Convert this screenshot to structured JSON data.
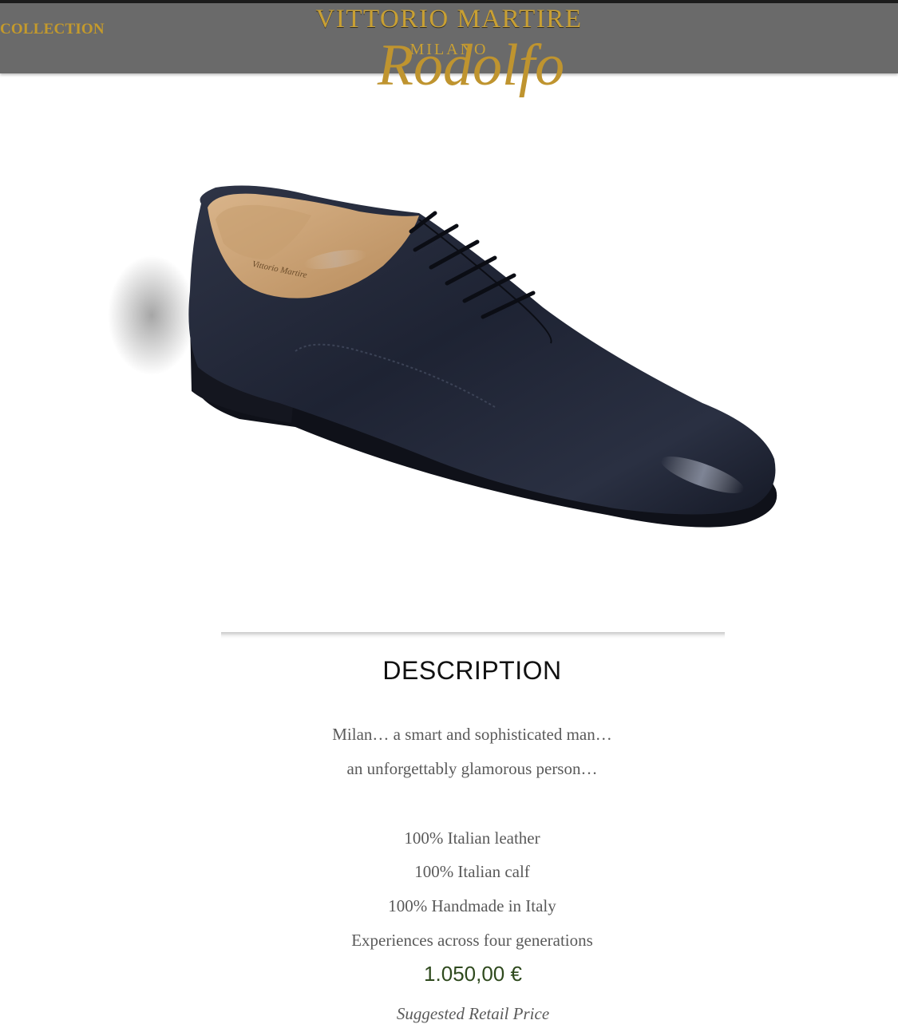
{
  "header": {
    "nav_collection": "COLLECTION",
    "brand_name": "VITTORIO MARTIRE",
    "brand_city": "MILANO",
    "product_name": "Rodolfo"
  },
  "product": {
    "image_alt": "navy blue leather oxford shoe"
  },
  "description": {
    "title": "DESCRIPTION",
    "intro": [
      "Milan… a smart and sophisticated man…",
      "an unforgettably glamorous person…"
    ],
    "features": [
      "100% Italian leather",
      "100% Italian calf",
      "100% Handmade in Italy",
      "Experiences across four generations"
    ],
    "price": "1.050,00 €",
    "price_note": "Suggested Retail Price"
  },
  "colors": {
    "header_bg": "#6a6a6a",
    "gold": "#c9a033",
    "price_green": "#2f4a1e",
    "shoe_leather": "#23293a"
  }
}
